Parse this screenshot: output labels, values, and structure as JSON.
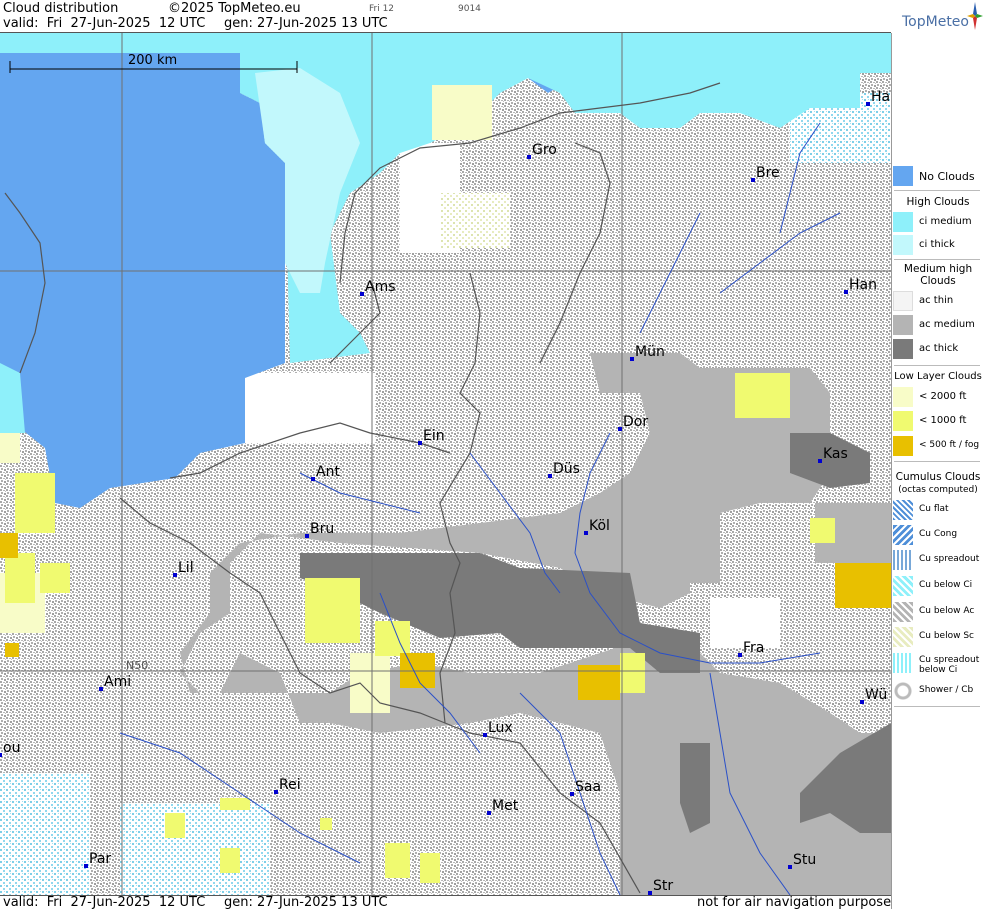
{
  "header": {
    "title": "Cloud distribution",
    "copyright": "©2025 TopMeteo.eu",
    "valid": "valid:  Fri  27-Jun-2025  12 UTC",
    "gen": "gen: 27-Jun-2025 13 UTC",
    "tag1": "Fri 12",
    "tag2": "9014",
    "logo": "TopMeteo"
  },
  "footer": {
    "valid": "valid:  Fri  27-Jun-2025  12 UTC",
    "gen": "gen: 27-Jun-2025 13 UTC",
    "disclaimer": "not for air navigation purposes"
  },
  "scale": {
    "label": "200 km"
  },
  "graticule": {
    "label": "N50"
  },
  "cities": [
    {
      "name": "Gro"
    },
    {
      "name": "Bre"
    },
    {
      "name": "Ha"
    },
    {
      "name": "Han"
    },
    {
      "name": "Ams"
    },
    {
      "name": "Mün"
    },
    {
      "name": "Dor"
    },
    {
      "name": "Ein"
    },
    {
      "name": "Kas"
    },
    {
      "name": "Ant"
    },
    {
      "name": "Düs"
    },
    {
      "name": "Bru"
    },
    {
      "name": "Köl"
    },
    {
      "name": "Lil"
    },
    {
      "name": "Fra"
    },
    {
      "name": "Ami"
    },
    {
      "name": "Wü"
    },
    {
      "name": "Lux"
    },
    {
      "name": "ou"
    },
    {
      "name": "Rei"
    },
    {
      "name": "Saa"
    },
    {
      "name": "Met"
    },
    {
      "name": "Par"
    },
    {
      "name": "Stu"
    },
    {
      "name": "Str"
    }
  ],
  "legend": {
    "no_clouds": "No Clouds",
    "high_head": "High Clouds",
    "ci_medium": "ci medium",
    "ci_thick": "ci thick",
    "medium_head_1": "Medium high",
    "medium_head_2": "Clouds",
    "ac_thin": "ac thin",
    "ac_medium": "ac medium",
    "ac_thick": "ac thick",
    "low_head": "Low Layer Clouds",
    "low_2000": "< 2000 ft",
    "low_1000": "< 1000 ft",
    "low_500": "< 500 ft / fog",
    "cu_head_1": "Cumulus Clouds",
    "cu_head_2": "(octas computed)",
    "cu_flat": "Cu flat",
    "cu_cong": "Cu Cong",
    "cu_spread": "Cu spreadout",
    "cu_below_ci": "Cu below Ci",
    "cu_below_ac": "Cu below Ac",
    "cu_below_sc": "Cu below Sc",
    "cu_spread_ci_1": "Cu spreadout",
    "cu_spread_ci_2": "below Ci",
    "shower": "Shower / Cb"
  },
  "colors": {
    "no_clouds": "#64a6f0",
    "ci_medium": "#8ef0fa",
    "ci_thick": "#c2f8fc",
    "ac_thin": "#f4f4f4",
    "ac_medium": "#b4b4b4",
    "ac_thick": "#7a7a7a",
    "low_2000": "#f8fcc8",
    "low_1000": "#f0fa70",
    "low_500": "#e8c000",
    "cu_below_ac": "#cfcfcf",
    "river": "#2a50c8",
    "border": "#555555",
    "city_dot": "#0000d0"
  }
}
